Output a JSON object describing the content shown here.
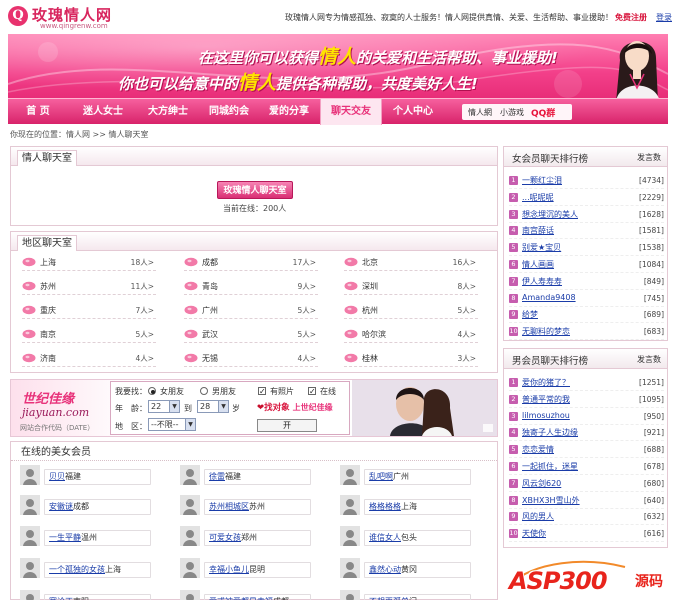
{
  "header": {
    "logo_mark": "Q",
    "logo_text": "玫瑰情人网",
    "logo_url": "www.qingrenw.com",
    "slogan": "玫瑰情人网专为情感孤独、寂寞的人士服务！情人网提供真情、关爱、生活帮助、事业援助！",
    "register": "免费注册",
    "login": "登录"
  },
  "banner": {
    "line1_pre": "在这里你可以获得",
    "line1_hl": "情人",
    "line1_post": "的关爱和生活帮助、事业援助!",
    "line2_pre": "你也可以给意中的",
    "line2_hl": "情人",
    "line2_post": "提供各种帮助，共度美好人生!"
  },
  "nav": {
    "items": [
      "首 页",
      "迷人女士",
      "大方绅士",
      "同城约会",
      "爱的分享",
      "聊天交友",
      "个人中心"
    ],
    "active_index": 5,
    "search_label1": "情人網",
    "search_label2": "小游戏",
    "qq_label": "QQ群"
  },
  "breadcrumb": "你现在的位置：情人网 >> 情人聊天室",
  "chat": {
    "title": "情人聊天室",
    "enter_button": "玫瑰情人聊天室",
    "online_text": "当前在线：200人"
  },
  "region": {
    "title": "地区聊天室",
    "rooms": [
      {
        "name": "上海",
        "count": "18人>"
      },
      {
        "name": "成都",
        "count": "17人>"
      },
      {
        "name": "北京",
        "count": "16人>"
      },
      {
        "name": "苏州",
        "count": "11人>"
      },
      {
        "name": "青岛",
        "count": "9人>"
      },
      {
        "name": "深圳",
        "count": "8人>"
      },
      {
        "name": "重庆",
        "count": "7人>"
      },
      {
        "name": "广州",
        "count": "5人>"
      },
      {
        "name": "杭州",
        "count": "5人>"
      },
      {
        "name": "南京",
        "count": "5人>"
      },
      {
        "name": "武汉",
        "count": "5人>"
      },
      {
        "name": "哈尔滨",
        "count": "4人>"
      },
      {
        "name": "济南",
        "count": "4人>"
      },
      {
        "name": "无锡",
        "count": "4人>"
      },
      {
        "name": "桂林",
        "count": "3人>"
      }
    ]
  },
  "ad": {
    "logo_cn": "世纪佳缘",
    "logo_en": "jiayuan.com",
    "logo_sub": "网站合作代码（DATE）",
    "seeking_label": "我要找：",
    "opt_female": "女朋友",
    "opt_male": "男朋友",
    "photo_label": "有照片",
    "online_label": "在线",
    "age_label": "年　龄：",
    "age_from": "22",
    "age_to_label": "到",
    "age_to": "28",
    "age_unit": "岁",
    "area_label": "地　区：",
    "area_value": "--不限--",
    "go_button": "开",
    "slogan1": "找对象",
    "slogan2": "上世纪佳缘"
  },
  "members": {
    "title": "在线的美女会员",
    "list": [
      {
        "name": "贝贝",
        "city": "福建"
      },
      {
        "name": "徐雷",
        "city": "福建"
      },
      {
        "name": "乱吧啊",
        "city": "广州"
      },
      {
        "name": "安徽谜",
        "city": "成都"
      },
      {
        "name": "苏州相城区",
        "city": "苏州"
      },
      {
        "name": "格格格格",
        "city": "上海"
      },
      {
        "name": "一生平静",
        "city": "温州"
      },
      {
        "name": "可爱女孩",
        "city": "郑州"
      },
      {
        "name": "谁信女人",
        "city": "包头"
      },
      {
        "name": "一个孤独的女孩",
        "city": "上海"
      },
      {
        "name": "幸福小鱼儿",
        "city": "昆明"
      },
      {
        "name": "鑫然心动",
        "city": "黄冈"
      },
      {
        "name": "寒论正",
        "city": "南阳"
      },
      {
        "name": "爱或被爱都是幸福",
        "city": "成都"
      },
      {
        "name": "不想再孤单",
        "city": "门"
      }
    ]
  },
  "female_rank": {
    "title": "女会员聊天排行榜",
    "col": "发言数",
    "rows": [
      {
        "name": "一颗红尘泪",
        "count": "[4734]"
      },
      {
        "name": "...呢呢呢",
        "count": "[2229]"
      },
      {
        "name": "想念埋沉的美人",
        "count": "[1628]"
      },
      {
        "name": "南宫薛话",
        "count": "[1581]"
      },
      {
        "name": "别爱★宝贝",
        "count": "[1538]"
      },
      {
        "name": "情人画画",
        "count": "[1084]"
      },
      {
        "name": "伊人寿寿寿",
        "count": "[849]"
      },
      {
        "name": "Amanda9408",
        "count": "[745]"
      },
      {
        "name": "给梦",
        "count": "[689]"
      },
      {
        "name": "无聊料的梦恋",
        "count": "[683]"
      }
    ]
  },
  "male_rank": {
    "title": "男会员聊天排行榜",
    "col": "发言数",
    "rows": [
      {
        "name": "爱你的猪了？",
        "count": "[1251]"
      },
      {
        "name": "普通平常的我",
        "count": "[1095]"
      },
      {
        "name": "lilmosuzhou",
        "count": "[950]"
      },
      {
        "name": "独寄子人生边缘",
        "count": "[921]"
      },
      {
        "name": "恋恋爱情",
        "count": "[688]"
      },
      {
        "name": "一起抓住，迷星",
        "count": "[678]"
      },
      {
        "name": "风云剑620",
        "count": "[680]"
      },
      {
        "name": "XBHX3H雪山外",
        "count": "[640]"
      },
      {
        "name": "风的男人",
        "count": "[632]"
      },
      {
        "name": "天使你",
        "count": "[616]"
      }
    ]
  },
  "watermark": {
    "brand": "ASP300",
    "suffix": "源码"
  },
  "colors": {
    "brand_pink": "#e8327a",
    "link_blue": "#1a3ca8",
    "rank_badge": "#c65dae"
  }
}
